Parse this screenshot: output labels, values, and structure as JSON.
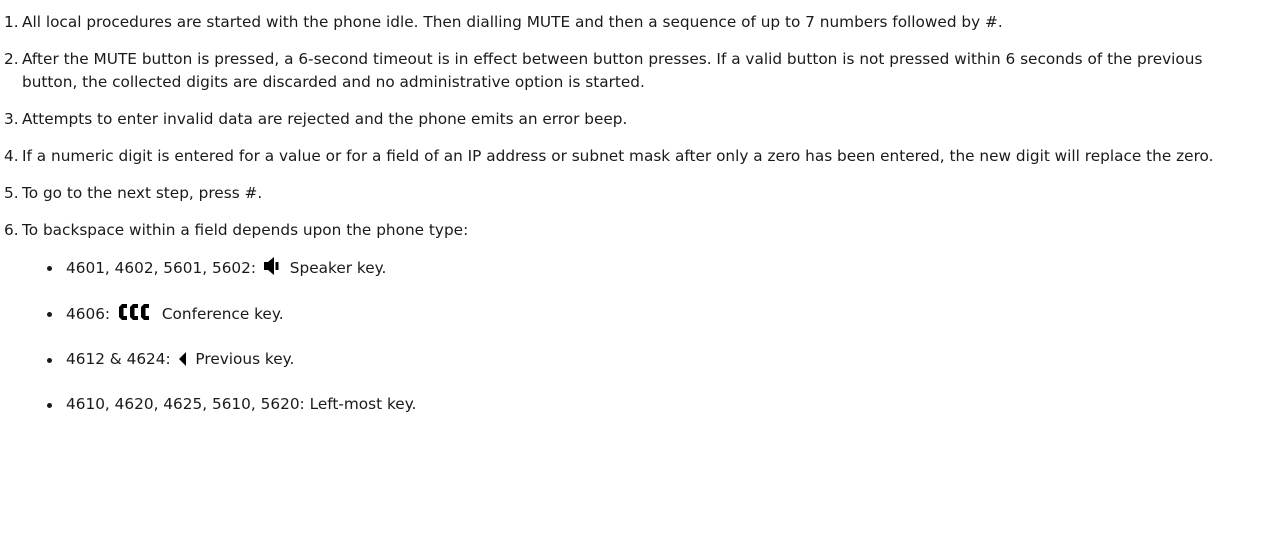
{
  "steps": [
    {
      "num": "1.",
      "text": "All local procedures are started with the phone idle. Then dialling MUTE and then a sequence of up to 7 numbers followed by #."
    },
    {
      "num": "2.",
      "text": "After the MUTE button is pressed, a 6-second timeout is in effect between button presses. If a valid button is not pressed within 6 seconds of the previous button, the collected digits are discarded and no administrative option is started."
    },
    {
      "num": "3.",
      "text": "Attempts to enter invalid data are rejected and the phone emits an error beep."
    },
    {
      "num": "4.",
      "text": "If a numeric digit is entered for a value or for a field of an IP address or subnet mask after only a zero has been entered, the new digit will replace the zero."
    },
    {
      "num": "5.",
      "text": "To go to the next step, press #."
    },
    {
      "num": "6.",
      "text": "To backspace within a field depends upon the phone type:"
    }
  ],
  "backspace_keys": [
    {
      "models": "4601, 4602, 5601, 5602:",
      "icon": "speaker-icon",
      "key": "Speaker key."
    },
    {
      "models": "4606:",
      "icon": "conference-icon",
      "key": "Conference key."
    },
    {
      "models": "4612 & 4624:",
      "icon": "previous-arrow-icon",
      "key": "Previous key."
    },
    {
      "models": "4610, 4620, 4625, 5610, 5620:",
      "icon": "",
      "key": "Left-most key."
    }
  ]
}
